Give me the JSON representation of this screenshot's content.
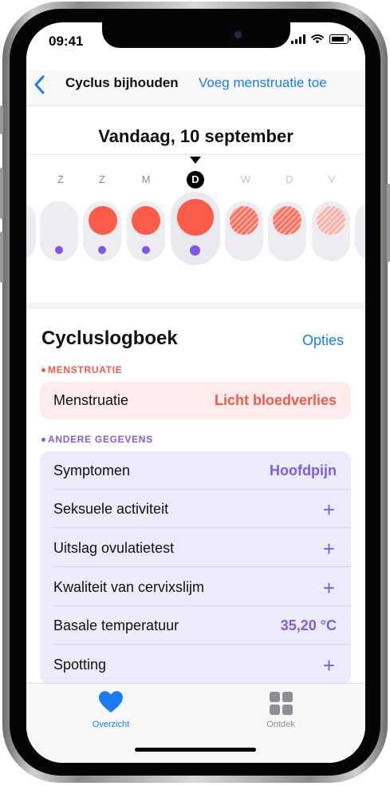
{
  "status": {
    "time": "09:41"
  },
  "nav": {
    "back_icon": "chevron-left-icon",
    "title": "Cyclus bijhouden",
    "action": "Voeg menstruatie toe"
  },
  "date_header": "Vandaag, 10 september",
  "days": [
    {
      "letter": "Z"
    },
    {
      "letter": "Z"
    },
    {
      "letter": "M"
    },
    {
      "letter": "D"
    },
    {
      "letter": "W"
    },
    {
      "letter": "D"
    },
    {
      "letter": "V"
    }
  ],
  "log": {
    "title": "Cycluslogboek",
    "options": "Opties",
    "menstruation_section": "MENSTRUATIE",
    "menstruation_row": {
      "label": "Menstruatie",
      "value": "Licht bloedverlies"
    },
    "other_section": "ANDERE GEGEVENS",
    "rows": [
      {
        "label": "Symptomen",
        "value": "Hoofdpijn"
      },
      {
        "label": "Seksuele activiteit",
        "value": "+"
      },
      {
        "label": "Uitslag ovulatietest",
        "value": "+"
      },
      {
        "label": "Kwaliteit van cervixslijm",
        "value": "+"
      },
      {
        "label": "Basale temperatuur",
        "value": "35,20 °C"
      },
      {
        "label": "Spotting",
        "value": "+"
      }
    ]
  },
  "tabs": [
    {
      "label": "Overzicht",
      "icon": "heart-icon"
    },
    {
      "label": "Ontdek",
      "icon": "grid-icon"
    }
  ],
  "colors": {
    "accent": "#1a7cf5",
    "period": "#fb5c4a",
    "other": "#7f5ce6"
  }
}
